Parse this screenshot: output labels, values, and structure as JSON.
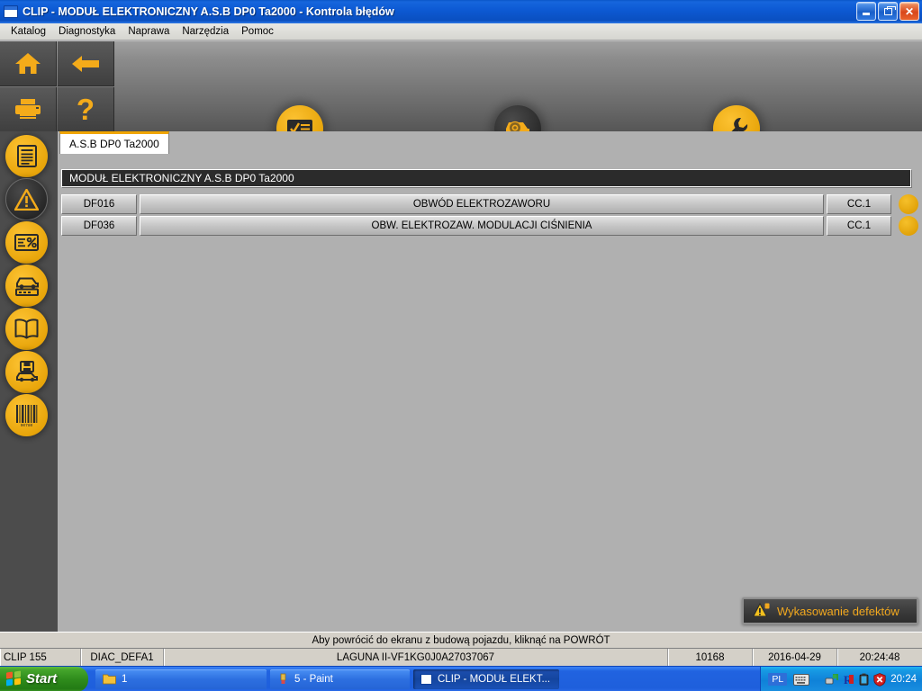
{
  "window": {
    "title": "CLIP - MODUŁ ELEKTRONICZNY A.S.B DP0 Ta2000 - Kontrola błędów",
    "icon": "window-icon",
    "controls": {
      "minimize": "minimize-button",
      "maximize": "maximize-button",
      "close": "✕"
    }
  },
  "menu": {
    "items": [
      {
        "label": "Katalog"
      },
      {
        "label": "Diagnostyka"
      },
      {
        "label": "Naprawa"
      },
      {
        "label": "Narzędzia"
      },
      {
        "label": "Pomoc"
      }
    ]
  },
  "toolbar": {
    "square_buttons": [
      {
        "name": "home-button",
        "icon": "home-icon"
      },
      {
        "name": "back-button",
        "icon": "arrow-left-icon"
      },
      {
        "name": "print-button",
        "icon": "printer-icon"
      },
      {
        "name": "help-button",
        "icon": "question-mark-icon",
        "glyph": "?"
      }
    ],
    "round_buttons": [
      {
        "name": "checklist-button",
        "icon": "checklist-icon",
        "state": "normal"
      },
      {
        "name": "vehicle-inspect-button",
        "icon": "car-magnifier-icon",
        "state": "active"
      },
      {
        "name": "tools-button",
        "icon": "wrench-icon",
        "state": "normal"
      }
    ]
  },
  "sidebar": {
    "items": [
      {
        "name": "sidebar-item-document",
        "icon": "document-icon",
        "state": "normal"
      },
      {
        "name": "sidebar-item-faults",
        "icon": "warning-triangle-icon",
        "state": "active"
      },
      {
        "name": "sidebar-item-parameters",
        "icon": "percent-report-icon",
        "state": "normal"
      },
      {
        "name": "sidebar-item-vehicle-config",
        "icon": "car-config-icon",
        "state": "normal"
      },
      {
        "name": "sidebar-item-documentation",
        "icon": "book-icon",
        "state": "normal"
      },
      {
        "name": "sidebar-item-save-vehicle",
        "icon": "save-car-icon",
        "state": "normal"
      },
      {
        "name": "sidebar-item-barcode",
        "icon": "barcode-icon",
        "state": "normal"
      }
    ]
  },
  "content": {
    "tab": {
      "label": "A.S.B DP0 Ta2000"
    },
    "module_header": "MODUŁ ELEKTRONICZNY A.S.B DP0 Ta2000",
    "faults": [
      {
        "code": "DF016",
        "description": "OBWÓD ELEKTROZAWORU",
        "status": "CC.1",
        "indicator": "present"
      },
      {
        "code": "DF036",
        "description": "OBW. ELEKTROZAW. MODULACJI CIŚNIENIA",
        "status": "CC.1",
        "indicator": "present"
      }
    ],
    "erase_button": {
      "label": "Wykasowanie defektów",
      "icon": "warning-erase-icon"
    }
  },
  "hint": {
    "text": "Aby powrócić do ekranu z budową pojazdu, kliknąć na POWRÓT"
  },
  "statusbar": {
    "app_version": "CLIP 155",
    "session": "DIAC_DEFA1",
    "vehicle": "LAGUNA II-VF1KG0J0A27037067",
    "spacer": "",
    "counter": "10168",
    "date": "2016-04-29",
    "time": "20:24:48"
  },
  "taskbar": {
    "start": "Start",
    "items": [
      {
        "label": "1",
        "icon": "folder-icon",
        "active": false
      },
      {
        "label": "5 - Paint",
        "icon": "paint-icon",
        "active": false
      },
      {
        "label": "CLIP - MODUŁ ELEKT...",
        "icon": "window-icon",
        "active": true
      }
    ],
    "tray": {
      "language": "PL",
      "keyboard_icon": "keyboard-icon",
      "icons": [
        "network-icon",
        "r-icon",
        "battery-icon",
        "security-shield-icon"
      ],
      "clock": "20:24"
    }
  },
  "colors": {
    "accent_yellow": "#f0a500",
    "titlebar_blue": "#0d5ad4",
    "sidebar_dark": "#4c4c4c",
    "content_gray": "#b0b0b0"
  }
}
